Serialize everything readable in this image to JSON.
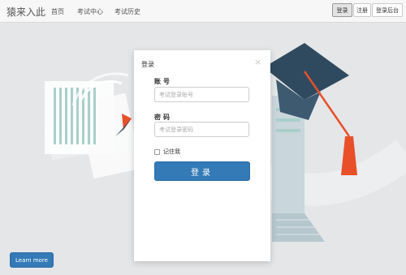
{
  "header": {
    "brand": "猿来入此",
    "nav": [
      "首页",
      "考试中心",
      "考试历史"
    ],
    "login": "登录",
    "register": "注册",
    "admin": "登录后台"
  },
  "modal": {
    "title": "登录",
    "account_label": "账号",
    "account_placeholder": "考试登录账号",
    "password_label": "密码",
    "password_placeholder": "考试登录密码",
    "remember": "记住我",
    "submit": "登录",
    "close_icon": "close-icon"
  },
  "hero": {
    "cta": "Learn more"
  },
  "colors": {
    "primary": "#337ab7",
    "cap": "#2f4a5f",
    "tassel": "#e8502a",
    "teal": "#8fc4c0"
  }
}
